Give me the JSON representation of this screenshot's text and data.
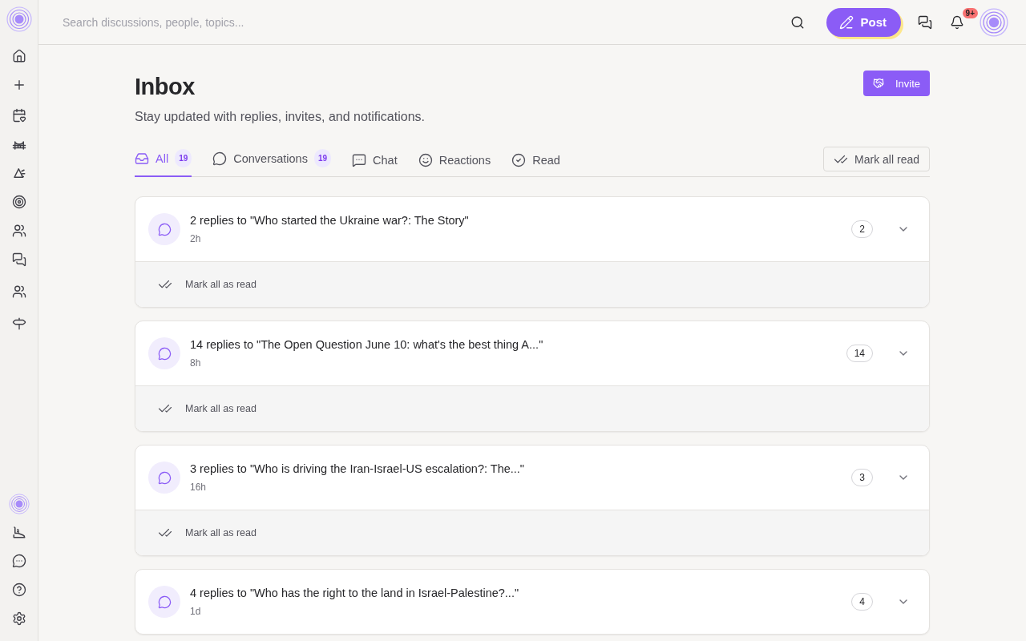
{
  "topbar": {
    "search_placeholder": "Search discussions, people, topics...",
    "post_label": "Post",
    "notification_count": "9+"
  },
  "header": {
    "title": "Inbox",
    "subtitle": "Stay updated with replies, invites, and notifications.",
    "invite_label": "Invite"
  },
  "tabs": [
    {
      "kind": "inbox",
      "label": "All",
      "count": "19",
      "selected": true
    },
    {
      "kind": "conversations",
      "label": "Conversations",
      "count": "19",
      "selected": false
    },
    {
      "kind": "chat",
      "label": "Chat",
      "selected": false
    },
    {
      "kind": "reactions",
      "label": "Reactions",
      "selected": false
    },
    {
      "kind": "read",
      "label": "Read",
      "selected": false
    }
  ],
  "mark_all_read": "Mark all read",
  "items": [
    {
      "title": "2 replies to \"Who started the Ukraine war?: The Story\"",
      "time": "2h",
      "count": "2",
      "footer": "Mark all as read"
    },
    {
      "title": "14 replies to \"The Open Question June 10: what's the best thing A...\"",
      "time": "8h",
      "count": "14",
      "footer": "Mark all as read"
    },
    {
      "title": "3 replies to \"Who is driving the Iran-Israel-US escalation?: The...\"",
      "time": "16h",
      "count": "3",
      "footer": "Mark all as read"
    },
    {
      "title": "4 replies to \"Who has the right to the land in Israel-Palestine?...\"",
      "time": "1d",
      "count": "4"
    }
  ]
}
